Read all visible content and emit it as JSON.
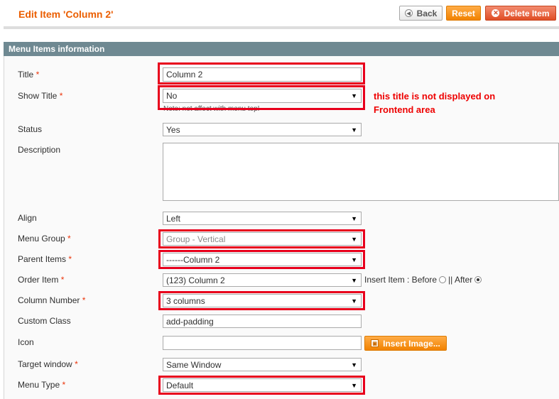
{
  "header": {
    "title": "Edit Item 'Column 2'",
    "back_label": "Back",
    "reset_label": "Reset",
    "delete_label": "Delete Item"
  },
  "section": {
    "title": "Menu Items information"
  },
  "fields": {
    "title": {
      "label": "Title",
      "required": "*",
      "value": "Column 2"
    },
    "show_title": {
      "label": "Show Title",
      "required": "*",
      "value": "No",
      "note": "Note: not affect with menu top!"
    },
    "status": {
      "label": "Status",
      "value": "Yes"
    },
    "description": {
      "label": "Description",
      "value": ""
    },
    "align": {
      "label": "Align",
      "value": "Left"
    },
    "menu_group": {
      "label": "Menu Group",
      "required": "*",
      "value": "Group - Vertical"
    },
    "parent_items": {
      "label": "Parent Items",
      "required": "*",
      "value": "------Column 2"
    },
    "order_item": {
      "label": "Order Item",
      "required": "*",
      "value": "(123) Column 2",
      "insert_label": "Insert Item : Before",
      "separator": "||",
      "after_label": "After",
      "selected": "After"
    },
    "column_number": {
      "label": "Column Number",
      "required": "*",
      "value": "3 columns"
    },
    "custom_class": {
      "label": "Custom Class",
      "value": "add-padding"
    },
    "icon": {
      "label": "Icon",
      "value": "",
      "button_label": "Insert Image..."
    },
    "target_window": {
      "label": "Target window",
      "required": "*",
      "value": "Same Window"
    },
    "menu_type": {
      "label": "Menu Type",
      "required": "*",
      "value": "Default"
    }
  },
  "annotation": "this title is not displayed on Frontend area",
  "icons": {
    "dropdown": "triangle-down-icon",
    "back": "back-arrow-icon",
    "delete": "delete-x-icon",
    "image": "image-icon"
  },
  "colors": {
    "title": "#eb5e00",
    "section": "#6f8992",
    "highlight": "#e8001c",
    "reset": "#f18200",
    "delete": "#e04d25"
  }
}
